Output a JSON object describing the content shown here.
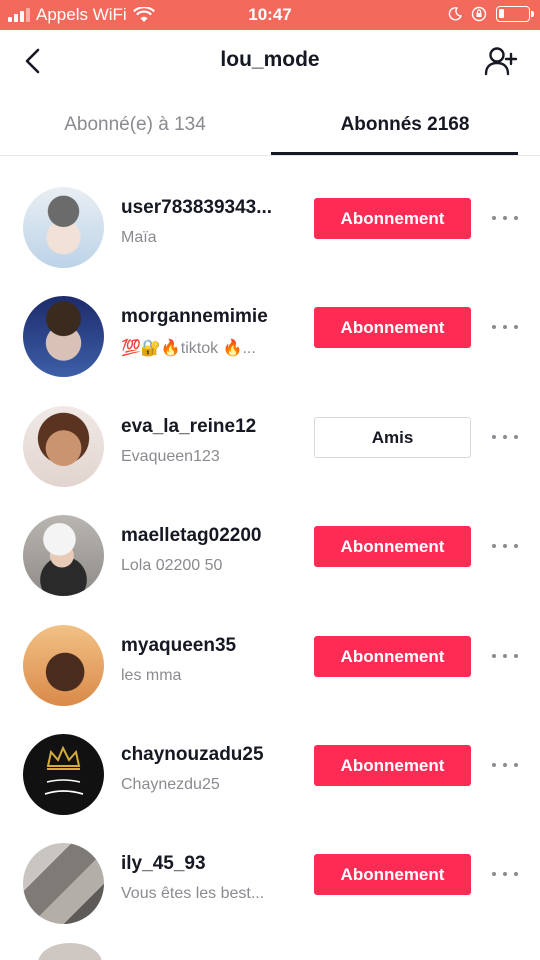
{
  "status_bar": {
    "carrier": "Appels WiFi",
    "time": "10:47"
  },
  "header": {
    "title": "lou_mode"
  },
  "tabs": [
    {
      "label": "Abonné(e) à 134",
      "active": false
    },
    {
      "label": "Abonnés 2168",
      "active": true
    }
  ],
  "followers": [
    {
      "username": "user783839343...",
      "subtitle": "Maïa",
      "button": "Abonnement",
      "avatar_color": "#c9d8e6"
    },
    {
      "username": "morgannemimie",
      "subtitle": "💯🔐🔥tiktok 🔥...",
      "button": "Abonnement",
      "avatar_color": "#2b3a7a"
    },
    {
      "username": "eva_la_reine12",
      "subtitle": "Evaqueen123",
      "button": "Amis",
      "avatar_color": "#e8d9d4"
    },
    {
      "username": "maelletag02200",
      "subtitle": "Lola 02200 50",
      "button": "Abonnement",
      "avatar_color": "#c8c4c0"
    },
    {
      "username": "myaqueen35",
      "subtitle": "les mma",
      "button": "Abonnement",
      "avatar_color": "#e7a15a"
    },
    {
      "username": "chaynouzadu25",
      "subtitle": "Chaynezdu25",
      "button": "Abonnement",
      "avatar_color": "#111111"
    },
    {
      "username": "ily_45_93",
      "subtitle": "Vous êtes les best...",
      "button": "Abonnement",
      "avatar_color": "#8d8a87"
    }
  ],
  "colors": {
    "accent": "#fe2c55",
    "status_bar": "#f36a5c"
  }
}
